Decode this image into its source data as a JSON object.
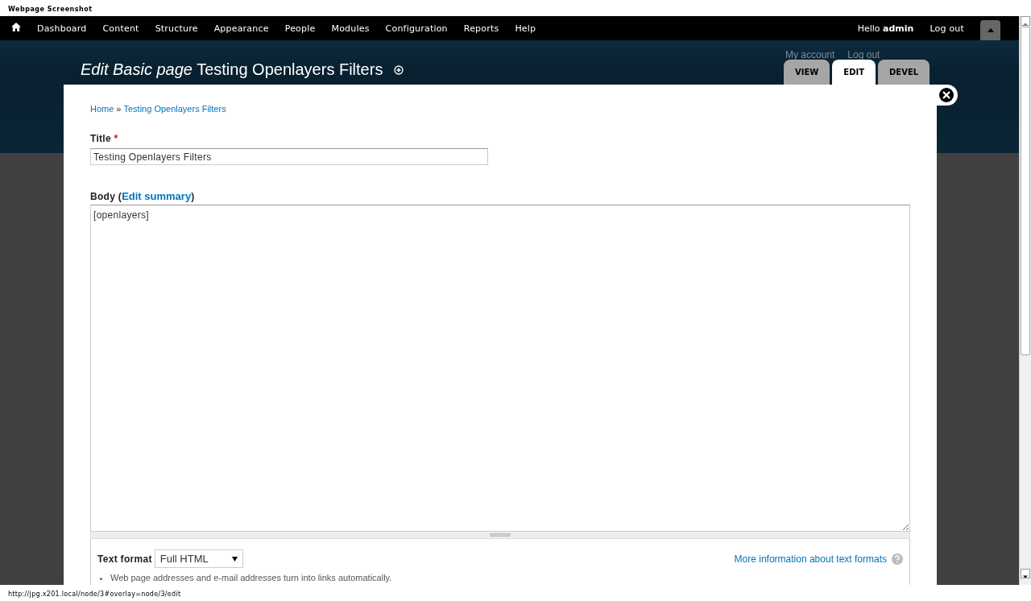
{
  "caption": "Webpage Screenshot",
  "toolbar": {
    "menu": [
      "Dashboard",
      "Content",
      "Structure",
      "Appearance",
      "People",
      "Modules",
      "Configuration",
      "Reports",
      "Help"
    ],
    "greeting": "Hello",
    "user": "admin",
    "logout": "Log out"
  },
  "header": {
    "secondary_links": [
      "My account",
      "Log out"
    ],
    "title": "*Edit Basic page* Testing Openlayers Filters",
    "tabs": [
      {
        "label": "VIEW",
        "selected": false
      },
      {
        "label": "EDIT",
        "selected": true
      },
      {
        "label": "DEVEL",
        "selected": false
      }
    ]
  },
  "breadcrumb": {
    "items": [
      "Home",
      "Testing Openlayers Filters"
    ],
    "separator": "»"
  },
  "title_field": {
    "label": "Title",
    "required_mark": "*",
    "value": "Testing Openlayers Filters"
  },
  "body_field": {
    "label_before": "Body (",
    "link": "Edit summary",
    "label_after": ")",
    "value": "[openlayers]"
  },
  "text_format": {
    "label": "Text format",
    "value": "Full HTML",
    "help_link": "More information about text formats",
    "tips": [
      "Web page addresses and e-mail addresses turn into links automatically."
    ]
  },
  "status_bar": "http://jpg.x201.local/node/3#overlay=node/3/edit"
}
